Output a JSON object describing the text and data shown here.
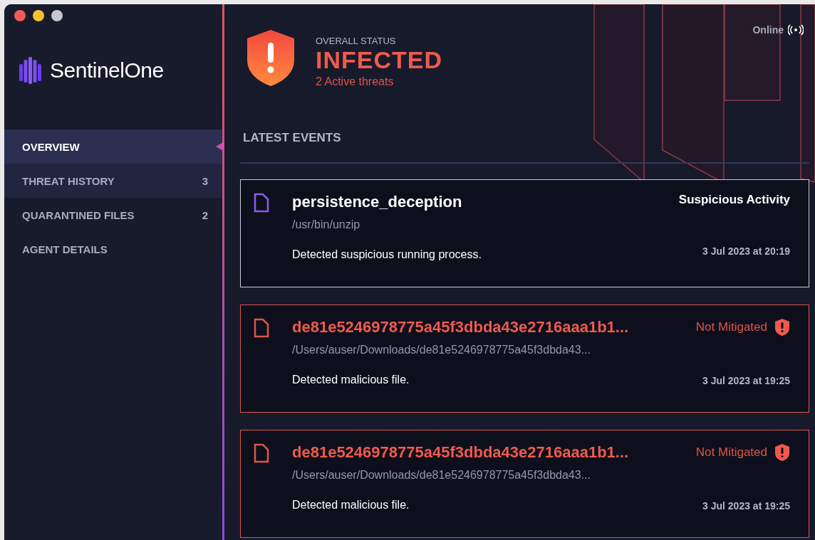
{
  "brand": {
    "name": "SentinelOne"
  },
  "sidebar": {
    "items": [
      {
        "label": "OVERVIEW",
        "selected": true,
        "hovered": false
      },
      {
        "label": "THREAT HISTORY",
        "count": "3",
        "selected": false,
        "hovered": true
      },
      {
        "label": "QUARANTINED FILES",
        "count": "2",
        "selected": false,
        "hovered": false
      },
      {
        "label": "AGENT DETAILS",
        "selected": false,
        "hovered": false
      }
    ]
  },
  "status": {
    "caption": "OVERALL STATUS",
    "state": "INFECTED",
    "detail": "2 Active threats",
    "connection": "Online"
  },
  "events_heading": "LATEST EVENTS",
  "events": [
    {
      "kind": "suspicious",
      "name": "persistence_deception",
      "path": "/usr/bin/unzip",
      "description": "Detected suspicious running process.",
      "status": "Suspicious Activity",
      "time": "3 Jul 2023 at 20:19"
    },
    {
      "kind": "malicious",
      "name": "de81e5246978775a45f3dbda43e2716aaa1b1...",
      "path": "/Users/auser/Downloads/de81e5246978775a45f3dbda43...",
      "description": "Detected malicious file.",
      "status": "Not Mitigated",
      "time": "3 Jul 2023 at 19:25"
    },
    {
      "kind": "malicious",
      "name": "de81e5246978775a45f3dbda43e2716aaa1b1...",
      "path": "/Users/auser/Downloads/de81e5246978775a45f3dbda43...",
      "description": "Detected malicious file.",
      "status": "Not Mitigated",
      "time": "3 Jul 2023 at 19:25"
    }
  ]
}
